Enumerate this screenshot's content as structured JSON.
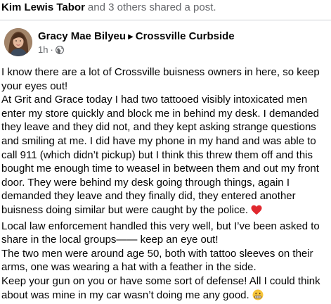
{
  "share_header": {
    "sharer_name": "Kim Lewis Tabor",
    "rest_text": "and 3 others shared a post."
  },
  "post": {
    "author": "Gracy Mae Bilyeu",
    "group": "Crossville Curbside",
    "arrow_glyph": "▶",
    "timestamp": "1h",
    "dot": "·",
    "privacy_icon": "globe-icon",
    "paragraphs": [
      "I know there are a lot of Crossville buisness owners in here, so keep your eyes out!",
      "At Grit and Grace today I had two tattooed visibly intoxicated men enter my store quickly and block me in behind my desk. I demanded they leave and they did not, and they kept asking strange questions and smiling at me. I did have my phone in my hand and was able to call 911 (which didn’t pickup) but I think this threw them off and this bought me enough time to weasel in between them and out my front door. They were behind my desk going through things, again I demanded they leave and they finally did, they entered another buisness doing similar but were caught by the police.",
      "Local law enforcement handled this very well, but I’ve been asked to share in the local groups—— keep an eye out!",
      "The two men were around age 50, both with tattoo sleeves on their arms, one was wearing a hat with a feather in the side.",
      "Keep your gun on you or have some sort of defense! All I could think about was mine in my car wasn’t doing me any good."
    ],
    "heart_emoji": "❤️",
    "grimace_emoji": "😬"
  }
}
